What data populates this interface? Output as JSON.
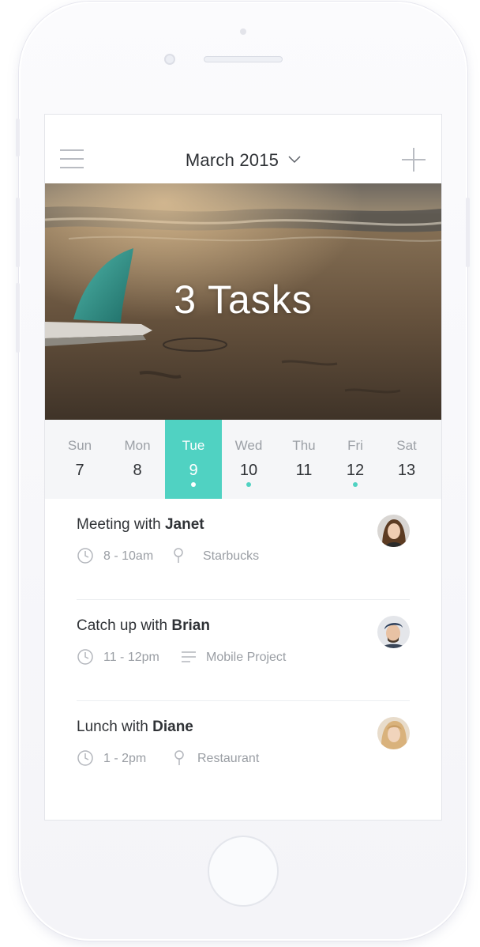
{
  "header": {
    "month_label": "March 2015",
    "menu_icon": "hamburger-menu-icon",
    "dropdown_icon": "chevron-down-icon",
    "add_icon": "plus-icon"
  },
  "hero": {
    "title": "3 Tasks",
    "image": "beach-surfboard-photo"
  },
  "week": {
    "days": [
      {
        "name": "Sun",
        "date": "7",
        "has_event": false,
        "selected": false
      },
      {
        "name": "Mon",
        "date": "8",
        "has_event": false,
        "selected": false
      },
      {
        "name": "Tue",
        "date": "9",
        "has_event": true,
        "selected": true
      },
      {
        "name": "Wed",
        "date": "10",
        "has_event": true,
        "selected": false
      },
      {
        "name": "Thu",
        "date": "11",
        "has_event": false,
        "selected": false
      },
      {
        "name": "Fri",
        "date": "12",
        "has_event": true,
        "selected": false
      },
      {
        "name": "Sat",
        "date": "13",
        "has_event": false,
        "selected": false
      }
    ]
  },
  "tasks": [
    {
      "prefix": "Meeting with ",
      "person": "Janet",
      "time": "8 - 10am",
      "detail": "Starbucks",
      "detail_icon": "location-pin-icon",
      "avatar": "janet-avatar"
    },
    {
      "prefix": "Catch up with ",
      "person": "Brian",
      "time": "11 - 12pm",
      "detail": "Mobile Project",
      "detail_icon": "list-lines-icon",
      "avatar": "brian-avatar"
    },
    {
      "prefix": "Lunch with ",
      "person": "Diane",
      "time": "1 - 2pm",
      "detail": "Restaurant",
      "detail_icon": "location-pin-icon",
      "avatar": "diane-avatar"
    }
  ],
  "colors": {
    "accent": "#50d2c2",
    "text_primary": "#2f3236",
    "text_secondary": "#9a9ea4",
    "week_background": "#f5f6f8"
  }
}
